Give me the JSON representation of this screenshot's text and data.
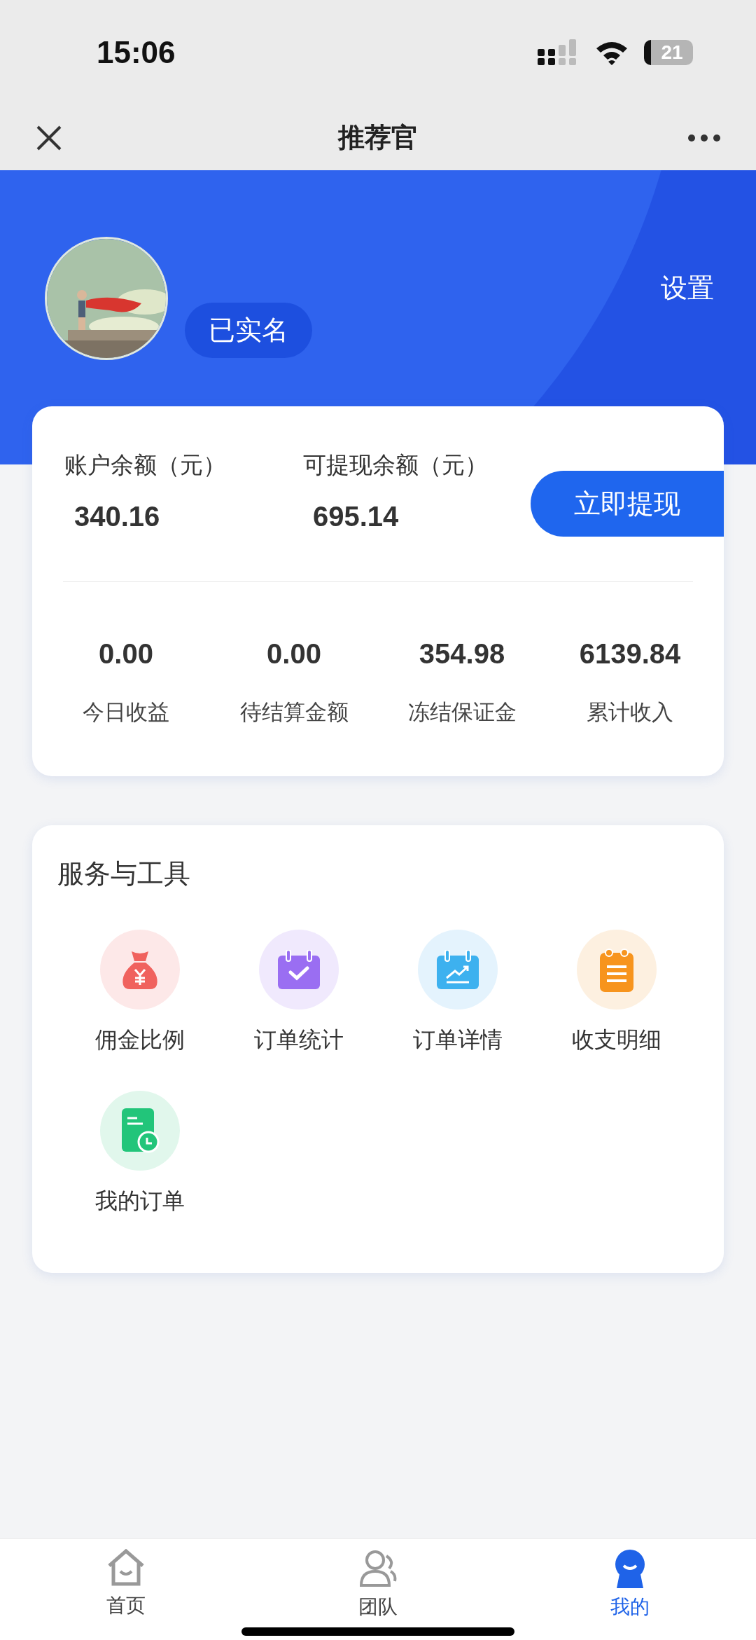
{
  "status_bar": {
    "time": "15:06",
    "battery": "21"
  },
  "header": {
    "title": "推荐官"
  },
  "profile": {
    "badge": "已实名",
    "settings": "设置"
  },
  "balance": {
    "items": [
      {
        "label": "账户余额（元）",
        "value": "340.16"
      },
      {
        "label": "可提现余额（元）",
        "value": "695.14"
      }
    ],
    "withdraw_button": "立即提现",
    "stats": [
      {
        "value": "0.00",
        "label": "今日收益"
      },
      {
        "value": "0.00",
        "label": "待结算金额"
      },
      {
        "value": "354.98",
        "label": "冻结保证金"
      },
      {
        "value": "6139.84",
        "label": "累计收入"
      }
    ]
  },
  "tools": {
    "title": "服务与工具",
    "items": [
      {
        "kind": "moneybag",
        "label": "佣金比例",
        "color": "#f0625e"
      },
      {
        "kind": "calendar-check",
        "label": "订单统计",
        "color": "#9a6ef2"
      },
      {
        "kind": "calendar-chart",
        "label": "订单详情",
        "color": "#3db1ef"
      },
      {
        "kind": "notepad",
        "label": "收支明细",
        "color": "#f7941d"
      },
      {
        "kind": "doc-clock",
        "label": "我的订单",
        "color": "#22c57a"
      }
    ]
  },
  "tab_bar": [
    {
      "kind": "home",
      "label": "首页",
      "selected": false
    },
    {
      "kind": "team",
      "label": "团队",
      "selected": false
    },
    {
      "kind": "me",
      "label": "我的",
      "selected": true
    }
  ]
}
